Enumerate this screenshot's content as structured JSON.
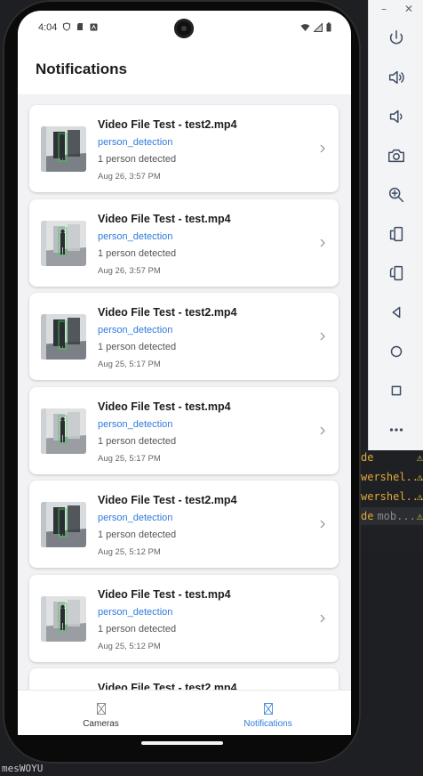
{
  "ide": {
    "lines": [
      {
        "text": "de",
        "extra": ""
      },
      {
        "text": "wershel...",
        "extra": ""
      },
      {
        "text": "wershel...",
        "extra": ""
      },
      {
        "text": "de",
        "extra": "mob..."
      }
    ],
    "bottom_text": "mesWOYU"
  },
  "emulator": {
    "minimize_label": "–",
    "close_label": "✕",
    "buttons": [
      "power-icon",
      "volume-up-icon",
      "volume-down-icon",
      "camera-icon",
      "zoom-icon",
      "rotate-left-icon",
      "rotate-right-icon",
      "back-icon",
      "home-icon",
      "overview-icon",
      "more-icon"
    ]
  },
  "status_bar": {
    "time": "4:04"
  },
  "header": {
    "title": "Notifications"
  },
  "notifications": [
    {
      "title": "Video File Test - test2.mp4",
      "type": "person_detection",
      "description": "1 person detected",
      "time": "Aug 26, 3:57 PM",
      "variant": "dark"
    },
    {
      "title": "Video File Test - test.mp4",
      "type": "person_detection",
      "description": "1 person detected",
      "time": "Aug 26, 3:57 PM",
      "variant": "light"
    },
    {
      "title": "Video File Test - test2.mp4",
      "type": "person_detection",
      "description": "1 person detected",
      "time": "Aug 25, 5:17 PM",
      "variant": "dark"
    },
    {
      "title": "Video File Test - test.mp4",
      "type": "person_detection",
      "description": "1 person detected",
      "time": "Aug 25, 5:17 PM",
      "variant": "light"
    },
    {
      "title": "Video File Test - test2.mp4",
      "type": "person_detection",
      "description": "1 person detected",
      "time": "Aug 25, 5:12 PM",
      "variant": "dark"
    },
    {
      "title": "Video File Test - test.mp4",
      "type": "person_detection",
      "description": "1 person detected",
      "time": "Aug 25, 5:12 PM",
      "variant": "light"
    },
    {
      "title": "Video File Test - test2.mp4",
      "type": "",
      "description": "",
      "time": "",
      "variant": "dark"
    }
  ],
  "tabs": [
    {
      "label": "Cameras",
      "active": false
    },
    {
      "label": "Notifications",
      "active": true
    }
  ],
  "colors": {
    "accent": "#2f7bdb",
    "tab_inactive": "#333333"
  }
}
